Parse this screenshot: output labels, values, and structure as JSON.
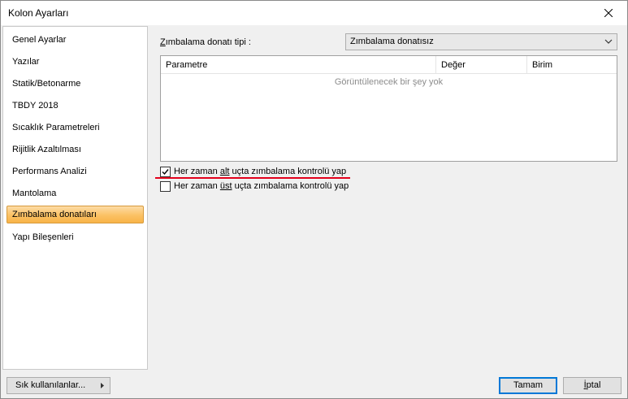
{
  "window": {
    "title": "Kolon Ayarları"
  },
  "nav": {
    "items": [
      {
        "label": "Genel Ayarlar"
      },
      {
        "label": "Yazılar"
      },
      {
        "label": "Statik/Betonarme"
      },
      {
        "label": "TBDY 2018"
      },
      {
        "label": "Sıcaklık Parametreleri"
      },
      {
        "label": "Rijitlik Azaltılması"
      },
      {
        "label": "Performans Analizi"
      },
      {
        "label": "Mantolama"
      },
      {
        "label": "Zımbalama donatıları",
        "selected": true
      },
      {
        "label": "Yapı Bileşenleri"
      }
    ]
  },
  "main": {
    "type_label_first": "Z",
    "type_label_rest": "ımbalama donatı tipi :",
    "type_value": "Zımbalama donatısız",
    "grid": {
      "columns": [
        "Parametre",
        "Değer",
        "Birim"
      ],
      "empty_text": "Görüntülenecek bir şey yok"
    },
    "checks": [
      {
        "pre": "Her zaman ",
        "ul": "alt",
        "post": " uçta zımbalama kontrolü yap",
        "checked": true
      },
      {
        "pre": "Her zaman ",
        "ul": "üst",
        "post": " uçta zımbalama kontrolü yap",
        "checked": false
      }
    ]
  },
  "footer": {
    "favorites_label": "Sık kullanılanlar...",
    "ok_label": "Tamam",
    "cancel_first": "İ",
    "cancel_rest": "ptal"
  },
  "colors": {
    "selected_nav": "#fbc164",
    "accent_red": "#e3001b",
    "focus_blue": "#0078d7"
  }
}
